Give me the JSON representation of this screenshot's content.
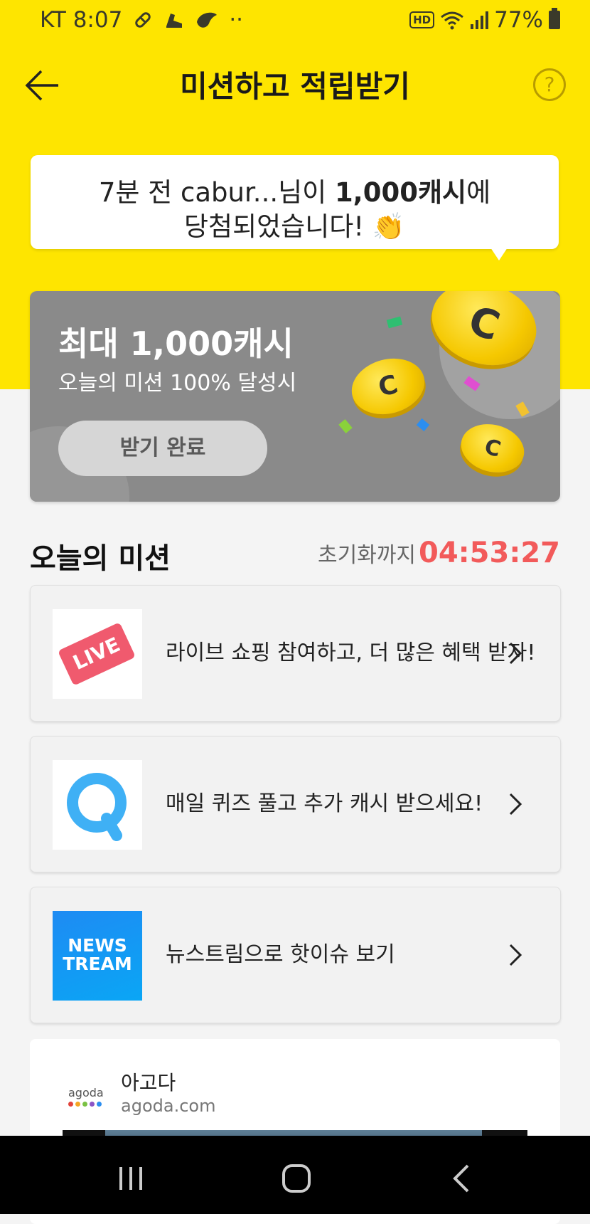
{
  "status_bar": {
    "carrier_time": "KT 8:07",
    "icons_left": [
      "pill-icon",
      "shoe-icon",
      "leaf-icon",
      "more-dots-icon"
    ],
    "dots": "··",
    "hd": "HD",
    "battery": "77%"
  },
  "header": {
    "title": "미션하고 적립받기",
    "help_symbol": "?"
  },
  "notice": {
    "line1_prefix": "7분 전 cabur...님이 ",
    "line1_bold": "1,000캐시",
    "line1_suffix": "에",
    "line2": "당첨되었습니다! 👏"
  },
  "banner": {
    "headline": "최대 1,000캐시",
    "subline": "오늘의 미션 100% 달성시",
    "button_label": "받기 완료",
    "coin_letter": "C"
  },
  "missions": {
    "title": "오늘의 미션",
    "reset_label": "초기화까지",
    "countdown": "04:53:27",
    "items": [
      {
        "label": "라이브 쇼핑 참여하고, 더 많은 혜택 받자!",
        "thumb_text": "LIVE",
        "icon": "live-icon"
      },
      {
        "label": "매일 퀴즈 풀고 추가 캐시 받으세요!",
        "thumb_text": "Q",
        "icon": "quiz-icon"
      },
      {
        "label": "뉴스트림으로 핫이슈 보기",
        "thumb_text_1": "NEWS",
        "thumb_text_2": "TREAM",
        "icon": "newstream-icon"
      }
    ]
  },
  "ad": {
    "logo_text": "agoda",
    "name": "아고다",
    "url": "agoda.com"
  },
  "nav": {
    "items": [
      "recents-icon",
      "home-icon",
      "back-icon"
    ]
  },
  "colors": {
    "header_yellow": "#fee500",
    "banner_gray": "#8a8a8a",
    "countdown_red": "#f25a5a",
    "coin_gold": "#f5c800"
  }
}
